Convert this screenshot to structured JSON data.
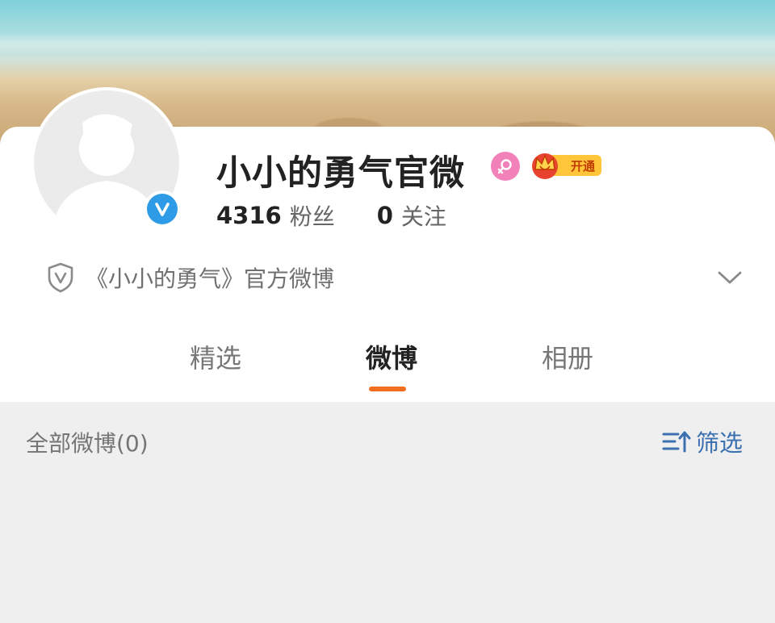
{
  "profile": {
    "name": "小小的勇气官微",
    "followers_count": "4316",
    "followers_label": "粉丝",
    "following_count": "0",
    "following_label": "关注",
    "intro": "《小小的勇气》官方微博",
    "vip_label": "开通"
  },
  "tabs": [
    {
      "label": "精选"
    },
    {
      "label": "微博"
    },
    {
      "label": "相册"
    }
  ],
  "feed": {
    "title": "全部微博(0)",
    "filter_label": "筛选"
  },
  "colors": {
    "accent": "#f36f1f",
    "verified_blue": "#2e9be6",
    "link_blue": "#3a6fb0",
    "female_pink": "#f281b9",
    "vip_gold": "#ffc63a"
  },
  "icons": [
    "verified-icon",
    "female-icon",
    "vip-crown-icon",
    "shield-icon",
    "chevron-down-icon",
    "filter-icon"
  ]
}
